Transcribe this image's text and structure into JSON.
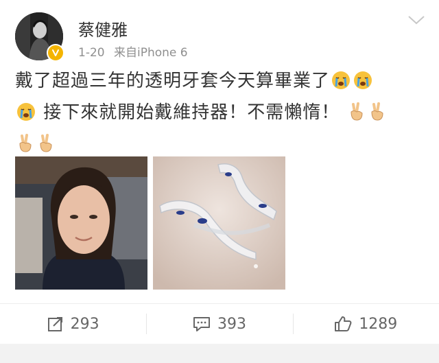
{
  "user": {
    "name": "蔡健雅",
    "date": "1-20",
    "source": "来自iPhone 6"
  },
  "post": {
    "line1": "戴了超過三年的透明牙套今天算畢業了",
    "line2": "接下來就開始戴維持器！不需懶惰！"
  },
  "actions": {
    "repost_count": "293",
    "comment_count": "393",
    "like_count": "1289"
  },
  "icons": [
    "verified-badge-icon",
    "chevron-down-icon",
    "crying-face-icon",
    "victory-hand-icon",
    "repost-icon",
    "comment-icon",
    "like-icon"
  ],
  "colors": {
    "text": "#333333",
    "meta": "#8f8f8f",
    "verified": "#f4b400",
    "action_text": "#666666"
  }
}
